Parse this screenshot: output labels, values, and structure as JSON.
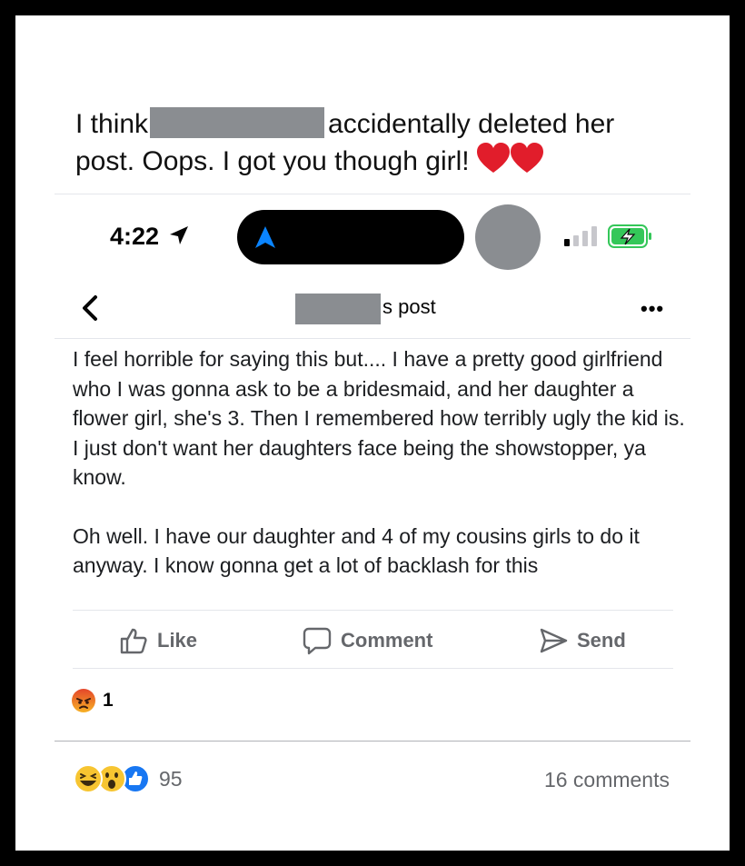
{
  "caption": {
    "before": "I think",
    "after": "accidentally deleted her post. Oops. I got you though girl!",
    "hearts": "❤️❤️"
  },
  "status_bar": {
    "time": "4:22"
  },
  "post_header": {
    "title_suffix": "s post"
  },
  "post": {
    "paragraph1": "I feel horrible for saying this but.... I have a pretty good girlfriend who I was gonna ask to be a bridesmaid, and her daughter a flower girl, she's 3. Then I remembered how terribly ugly the kid is. I just don't want her daughters face being the showstopper, ya know.",
    "paragraph2": "Oh well. I have our daughter and 4 of my cousins girls to do it anyway. I know  gonna get a lot of backlash for this"
  },
  "actions": {
    "like": "Like",
    "comment": "Comment",
    "send": "Send"
  },
  "inner_reactions": {
    "count": "1"
  },
  "outer_footer": {
    "reaction_count": "95",
    "comments": "16 comments"
  },
  "colors": {
    "redaction": "#8a8d91",
    "muted_text": "#65676b",
    "divider": "#e4e6eb",
    "battery_green": "#34c759",
    "nav_blue": "#0a84ff",
    "like_blue": "#1877f2",
    "angry_red": "#e4452b"
  }
}
